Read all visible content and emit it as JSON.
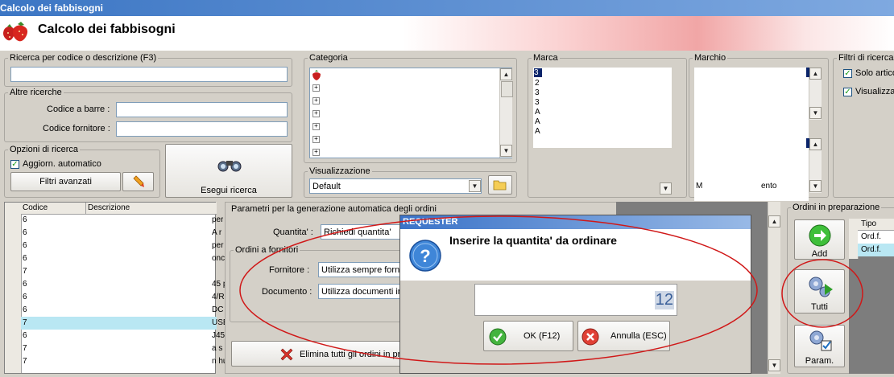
{
  "window": {
    "title": "Calcolo dei fabbisogni"
  },
  "header": {
    "title": "Calcolo dei fabbisogni",
    "logo_icon": "strawberry-icon"
  },
  "search": {
    "legend": "Ricerca per codice o descrizione (F3)",
    "value": "",
    "other_legend": "Altre ricerche",
    "barcode_label": "Codice a barre :",
    "supplier_code_label": "Codice fornitore :"
  },
  "options": {
    "legend": "Opzioni di ricerca",
    "auto_update_label": "Aggiorn. automatico",
    "auto_update_checked": true,
    "advanced_filters_button": "Filtri avanzati",
    "execute_search_button": "Esegui ricerca"
  },
  "categoria": {
    "legend": "Categoria"
  },
  "visualizzazione": {
    "legend": "Visualizzazione",
    "value": "Default"
  },
  "marca": {
    "legend": "Marca",
    "rows": [
      "3",
      "2",
      "3",
      "3",
      "A",
      "A",
      "A"
    ]
  },
  "marchio": {
    "legend": "Marchio",
    "bottom_row_start": "M",
    "bottom_row_end": "ento"
  },
  "filtri": {
    "legend": "Filtri di ricerca",
    "opt1_label": "Solo artico",
    "opt1_checked": true,
    "opt2_label": "Visualizza",
    "opt2_checked": true
  },
  "grid": {
    "headers": [
      "Codice",
      "Descrizione"
    ],
    "rows": [
      {
        "code": "6",
        "tail": "per"
      },
      {
        "code": "6",
        "tail": "A r"
      },
      {
        "code": "6",
        "tail": "per c"
      },
      {
        "code": "6",
        "tail": "onc"
      },
      {
        "code": "7",
        "tail": ""
      },
      {
        "code": "6",
        "tail": "45 p"
      },
      {
        "code": "6",
        "tail": "4/R"
      },
      {
        "code": "6",
        "tail": "DC"
      },
      {
        "code": "7",
        "tail": "USE"
      },
      {
        "code": "6",
        "tail": "J45"
      },
      {
        "code": "7",
        "tail": "a s"
      },
      {
        "code": "7",
        "tail": "n hu"
      }
    ]
  },
  "params": {
    "legend": "Parametri per la generazione automatica degli ordini",
    "quantity_label": "Quantita' :",
    "quantity_value": "Richiedi quantita'",
    "orders_legend": "Ordini a fornitori",
    "supplier_label": "Fornitore :",
    "supplier_value": "Utilizza sempre forni",
    "document_label": "Documento :",
    "document_value": "Utilizza documenti in",
    "delete_all_button": "Elimina tutti gli ordini in pre"
  },
  "ordini": {
    "legend": "Ordini in preparazione",
    "add_button": "Add",
    "all_button": "Tutti",
    "params_button": "Param.",
    "table_header": "Tipo",
    "rows": [
      "Ord.f.",
      "Ord.f."
    ]
  },
  "requester": {
    "title": "REQUESTER",
    "prompt": "Inserire la quantita' da ordinare",
    "value": "12",
    "ok_button": "OK (F12)",
    "cancel_button": "Annulla (ESC)"
  },
  "colors": {
    "titlebar": "#3c76c4",
    "annotation": "#d01818",
    "selection": "#b9e7f3"
  }
}
